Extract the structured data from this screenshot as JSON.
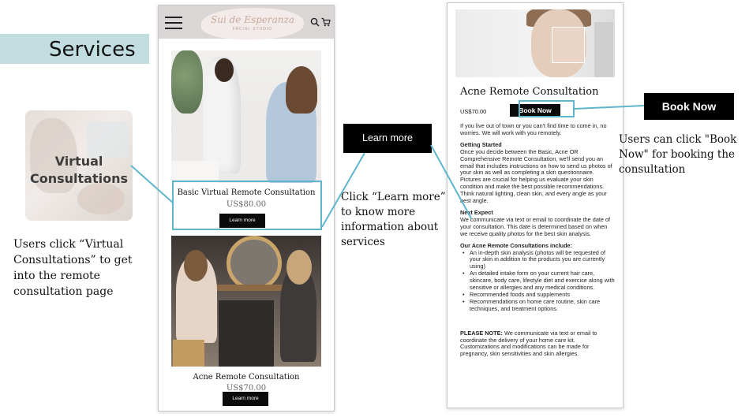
{
  "section": {
    "title": "Services"
  },
  "left_panel": {
    "tile_label_line1": "Virtual",
    "tile_label_line2": "Consultations",
    "note": "Users click “Virtual Consultations” to get into the remote consultation page"
  },
  "screen1": {
    "logo_text": "Sui de Esperanza",
    "logo_subtext": "FACIAL STUDIO",
    "cards": [
      {
        "title": "Basic Virtual Remote Consultation",
        "price": "US$80.00",
        "button": "Learn more"
      },
      {
        "title": "Acne Remote Consultation",
        "price": "US$70.00",
        "button": "Learn more"
      }
    ]
  },
  "learn_more_callout": {
    "label": "Learn more",
    "note": "Click “Learn more” to know more information about services"
  },
  "screen2": {
    "title": "Acne Remote Consultation",
    "price": "US$70.00",
    "book_button": "Book Now",
    "intro": "If you live out of town or you can't find time to come in, no worries. We will work with you remotely.",
    "getting_started_heading": "Getting Started",
    "getting_started_text": "Once you decide between the Basic, Acne OR Comprehensive Remote Consultation, we'll send you an email that includes instructions on how to send us photos of your skin as well as completing a skin questionnaire. Pictures are crucial for helping us evaluate your skin condition and make the best possible recommendations. Think natural lighting, clean skin, and every angle as your best angle.",
    "next_expect_heading": "Next Expect",
    "next_expect_text": "We communicate via text or email to coordinate the date of your consultation. This date is determined based on when we receive quality photos for the best skin analysis.",
    "includes_heading": "Our Acne Remote Consultations include:",
    "includes": [
      "An in-depth skin analysis (photos will be requested of your skin in addition to the products you are currently using)",
      "An detailed intake form on your current hair care, skincare, body care, lifestyle diet and exercise along with sensitive or allergies and any medical conditions.",
      "Recommended foods and supplements",
      "Recommendations on home care routine, skin care techniques, and treatment options."
    ],
    "please_note_label": "PLEASE NOTE:",
    "please_note_text": " We communicate via text or email to coordinate the delivery of your home care kit. Customizations and modifications can be made for pregnancy, skin sensitivities and skin allergies."
  },
  "book_now_callout": {
    "label": "Book Now",
    "note": "Users can click \"Book Now\" for booking the consultation"
  },
  "colors": {
    "accent": "#5fb5cb",
    "banner": "#c1dde0",
    "button": "#0b0b0b"
  }
}
